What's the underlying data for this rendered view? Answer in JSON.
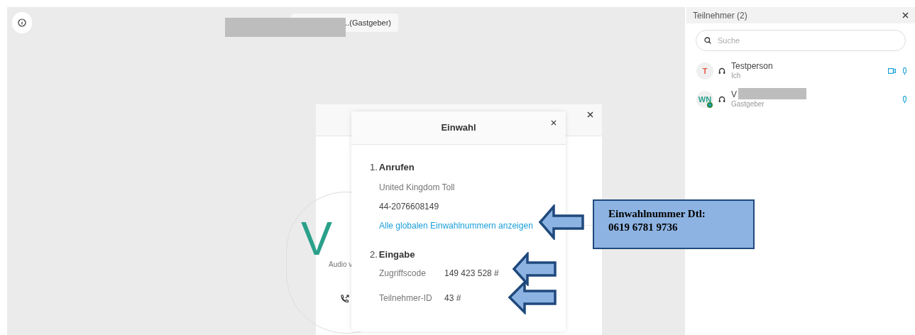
{
  "meeting": {
    "host_tag": "..(Gastgeber)"
  },
  "participants_panel": {
    "title": "Teilnehmer (2)",
    "search": {
      "placeholder": "Suche"
    },
    "participants": [
      {
        "initials": "T",
        "name": "Testperson",
        "role": "Ich",
        "color": "#e8594a",
        "video": true,
        "badge": false
      },
      {
        "initials": "WN",
        "name": "V",
        "role": "Gastgeber",
        "color": "#2aa08a",
        "video": false,
        "badge": true
      }
    ]
  },
  "audio_dialog": {
    "avatar_letter": "V",
    "label": "Audio v"
  },
  "dialin_dialog": {
    "title": "Einwahl",
    "steps": [
      {
        "number": "1.",
        "heading": "Anrufen",
        "kind": "call",
        "lines": [
          "United Kingdom Toll",
          "44-2076608149"
        ],
        "link": "Alle globalen Einwahlnummern anzeigen"
      },
      {
        "number": "2.",
        "heading": "Eingabe",
        "kind": "codes",
        "fields": [
          {
            "label": "Zugriffscode",
            "value": "149 423 528 #"
          },
          {
            "label": "Teilnehmer-ID",
            "value": "43 #"
          }
        ]
      }
    ]
  },
  "annotation": {
    "lines": [
      "Einwahlnummer Dtl:",
      "0619 6781 9736"
    ]
  }
}
